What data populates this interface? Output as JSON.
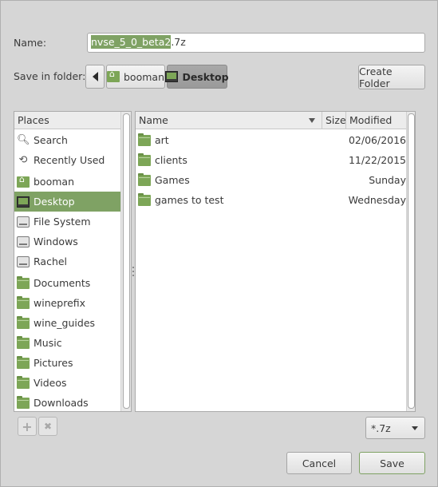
{
  "dialog": {
    "name_label": "Name:",
    "name_selected": "nvse_5_0_beta2",
    "name_rest": ".7z",
    "save_in_label": "Save in folder:",
    "crumbs": [
      "booman",
      "Desktop"
    ],
    "create_folder_label": "Create Folder"
  },
  "places": {
    "header": "Places",
    "items": [
      {
        "label": "Search",
        "icon": "search-icon"
      },
      {
        "label": "Recently Used",
        "icon": "recent-icon"
      },
      {
        "label": "booman",
        "icon": "home-folder-icon"
      },
      {
        "label": "Desktop",
        "icon": "desktop-icon",
        "selected": true
      },
      {
        "label": "File System",
        "icon": "drive-icon"
      },
      {
        "label": "Windows",
        "icon": "drive-icon"
      },
      {
        "label": "Rachel",
        "icon": "drive-icon"
      },
      {
        "label": "Documents",
        "icon": "folder-icon"
      },
      {
        "label": "wineprefix",
        "icon": "folder-icon"
      },
      {
        "label": "wine_guides",
        "icon": "folder-icon"
      },
      {
        "label": "Music",
        "icon": "music-folder-icon"
      },
      {
        "label": "Pictures",
        "icon": "pictures-folder-icon"
      },
      {
        "label": "Videos",
        "icon": "videos-folder-icon"
      },
      {
        "label": "Downloads",
        "icon": "downloads-folder-icon"
      }
    ],
    "add_glyph": "+",
    "remove_glyph": "✖"
  },
  "files": {
    "columns": {
      "name": "Name",
      "size": "Size",
      "modified": "Modified"
    },
    "rows": [
      {
        "name": "art",
        "size": "",
        "modified": "02/06/2016"
      },
      {
        "name": "clients",
        "size": "",
        "modified": "11/22/2015"
      },
      {
        "name": "Games",
        "size": "",
        "modified": "Sunday"
      },
      {
        "name": "games to test",
        "size": "",
        "modified": "Wednesday"
      }
    ]
  },
  "filter": {
    "value": "*.7z"
  },
  "buttons": {
    "cancel": "Cancel",
    "save": "Save"
  },
  "colors": {
    "accent": "#7fa264",
    "background": "#d6d6d6"
  }
}
